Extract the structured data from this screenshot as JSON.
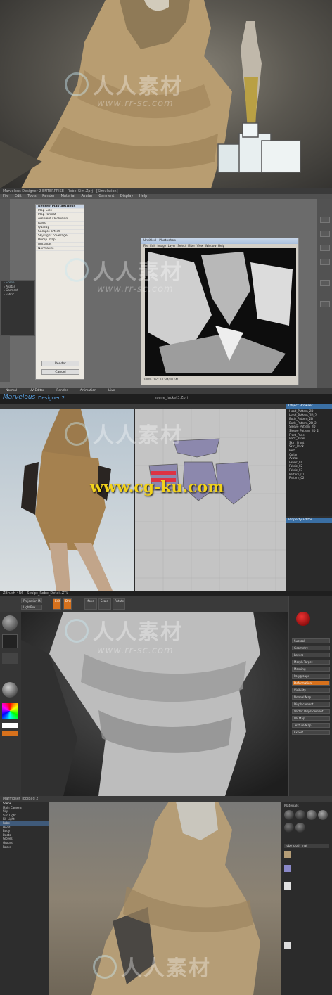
{
  "watermarks": {
    "brand_cn": "人人素材",
    "site_rr": "www.rr-sc.com",
    "site_cg": "www.cg-ku.com"
  },
  "panel2": {
    "title": "Marvelous Designer 2 ENTERPRISE - Robe_Sim.Zprj - [Simulation]",
    "menus": [
      "File",
      "Edit",
      "Tools",
      "Render",
      "Material",
      "Avatar",
      "Garment",
      "Display",
      "Help"
    ],
    "dialog_title": "Render Map Settings",
    "dialog_rows": [
      "Map Size",
      "Map format",
      "Ambient Occlusion",
      "Rays",
      "Quality",
      "Sample offset",
      "Sky light coverage",
      "Bump map",
      "Antialias",
      "Normalize",
      "Render",
      "Cancel"
    ],
    "image_window_title": "Untitled - Photoshop",
    "image_menus": [
      "File",
      "Edit",
      "Image",
      "Layer",
      "Select",
      "Filter",
      "View",
      "Window",
      "Help"
    ],
    "status_text": "100% Doc: 10.5M/10.5M",
    "bottom_tabs": [
      "Normal",
      "UV Editor",
      "Render",
      "Animation",
      "Live"
    ]
  },
  "panel3": {
    "app_name": "Marvelous",
    "app_subtitle": "Designer 2",
    "scene_title": "scene_Jacket3.Zprj",
    "outliner_title": "Object Browser",
    "outliner_items": [
      "Hood_Pattern_2D",
      "Hood_Pattern_2D_2",
      "Body_Pattern_2D",
      "Body_Pattern_2D_2",
      "Sleeve_Pattern_2D",
      "Sleeve_Pattern_2D_2",
      "Front_Panel",
      "Back_Panel",
      "Skirt_Front",
      "Skirt_Back",
      "Belt",
      "Collar",
      "Avatar",
      "Fabric_01",
      "Fabric_02",
      "Fabric_03",
      "Pattern_01",
      "Pattern_02"
    ],
    "property_title": "Property Editor"
  },
  "panel4": {
    "title": "ZBrush 4R6 - Sculpt_Robe_Detail.ZTL",
    "top_buttons": [
      "Projection Master",
      "LightBox",
      "Quick Sketch",
      "Edit",
      "Draw",
      "Move",
      "Scale",
      "Rotate"
    ],
    "right_buttons": [
      "Subtool",
      "Geometry",
      "Layers",
      "Morph Target",
      "Masking",
      "Polygroups",
      "Deformation",
      "Visibility",
      "Normal Map",
      "Displacement",
      "Vector Displacement",
      "UV Map",
      "Texture Map",
      "Export"
    ],
    "active_tool": "Standard"
  },
  "panel5": {
    "title": "Marmoset Toolbag 2",
    "scene_items": [
      "Scene",
      "Main Camera",
      "Sky",
      "Sun Light",
      "Fill Light",
      "Robe",
      "Hood",
      "Body",
      "Boots",
      "Gloves",
      "Ground",
      "Rocks"
    ],
    "right_section": "Materials",
    "material_name": "robe_cloth_mat"
  },
  "colors": {
    "cloth": "#c8aa7a",
    "orange_ui": "#d7711c",
    "marvelous_blue": "#2f6fb0"
  }
}
